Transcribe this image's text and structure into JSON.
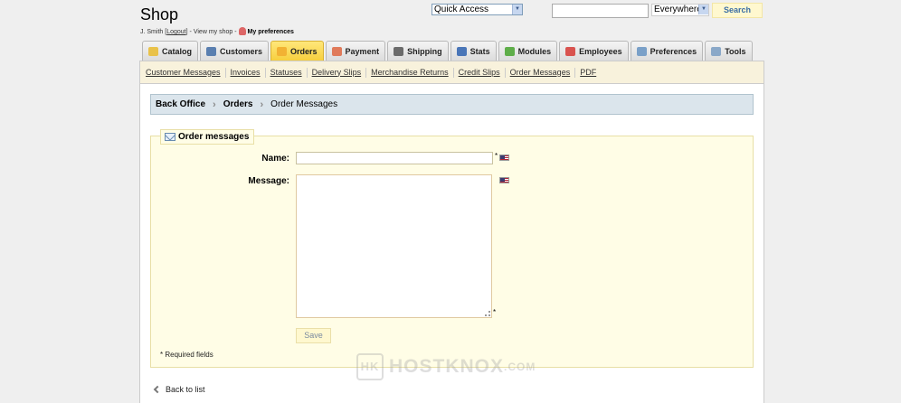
{
  "header": {
    "title": "Shop",
    "user_name": "J. Smith",
    "logout": "Logout",
    "view_shop": "View my shop",
    "my_preferences": "My preferences",
    "sep1": "[",
    "sep2": "]",
    "dash1": "-",
    "dash2": "-"
  },
  "quick_access": {
    "value": "Quick Access"
  },
  "search": {
    "scope": "Everywhere",
    "button": "Search",
    "value": ""
  },
  "tabs": [
    {
      "label": "Catalog",
      "icon": "folder-icon",
      "color": "#e9c24a"
    },
    {
      "label": "Customers",
      "icon": "user-icon",
      "color": "#5a7fb0"
    },
    {
      "label": "Orders",
      "icon": "cart-icon",
      "color": "#f2b233",
      "active": true
    },
    {
      "label": "Payment",
      "icon": "payment-icon",
      "color": "#e07a5a"
    },
    {
      "label": "Shipping",
      "icon": "truck-icon",
      "color": "#6b6b6b"
    },
    {
      "label": "Stats",
      "icon": "bar-chart-icon",
      "color": "#4a76b8"
    },
    {
      "label": "Modules",
      "icon": "puzzle-icon",
      "color": "#5fae4a"
    },
    {
      "label": "Employees",
      "icon": "employee-icon",
      "color": "#d9534f"
    },
    {
      "label": "Preferences",
      "icon": "preferences-icon",
      "color": "#7aa0c8"
    },
    {
      "label": "Tools",
      "icon": "wrench-icon",
      "color": "#8aa8c8"
    }
  ],
  "subnav": [
    "Customer Messages",
    "Invoices",
    "Statuses",
    "Delivery Slips",
    "Merchandise Returns",
    "Credit Slips",
    "Order Messages",
    "PDF"
  ],
  "breadcrumb": {
    "root": "Back Office",
    "section": "Orders",
    "page": "Order Messages"
  },
  "form": {
    "legend": "Order messages",
    "name_label": "Name:",
    "message_label": "Message:",
    "required_mark": "*",
    "save": "Save",
    "required_note": "* Required fields",
    "name_value": "",
    "message_value": ""
  },
  "watermark": {
    "logo": "HK",
    "text": "HOSTKNOX",
    "suffix": ".COM"
  },
  "back_link": "Back to list"
}
